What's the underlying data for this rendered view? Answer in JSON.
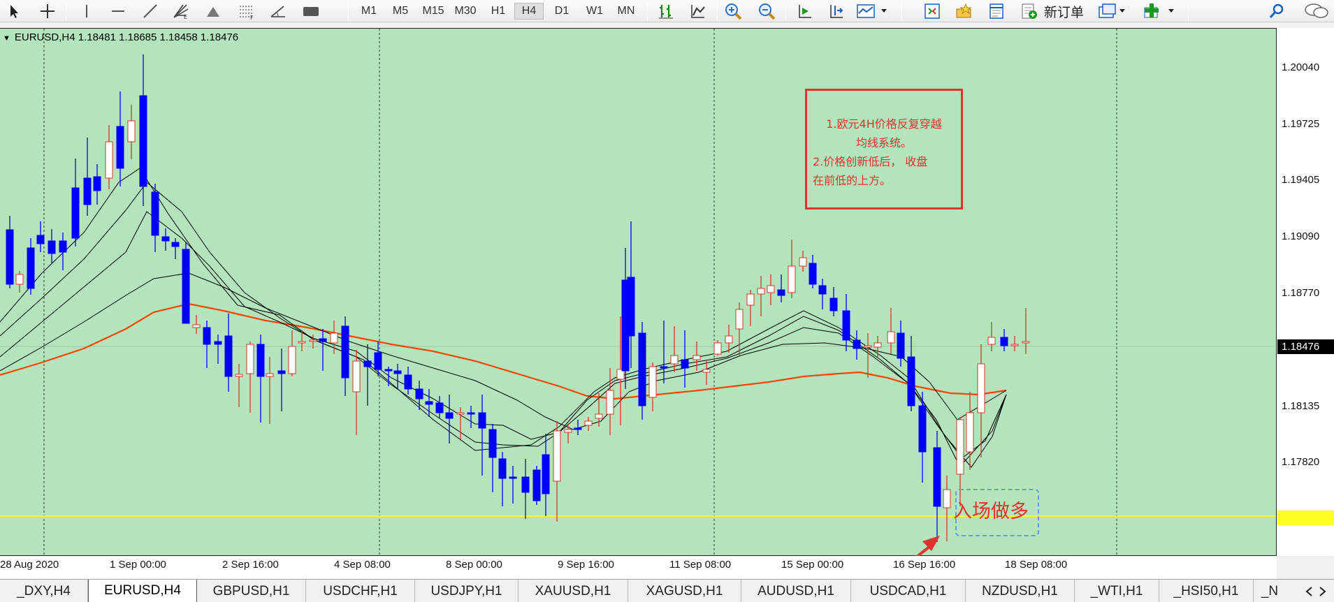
{
  "toolbar": {
    "tools": [
      "cursor-arrow",
      "crosshair",
      "vertical-line",
      "horizontal-line",
      "trend-line",
      "fibonacci-fan",
      "triangle-shape",
      "fibonacci-grid",
      "angle-line",
      "rectangle-shape"
    ],
    "timeframes": [
      "M1",
      "M5",
      "M15",
      "M30",
      "H1",
      "H4",
      "D1",
      "W1",
      "MN"
    ],
    "active_timeframe": "H4",
    "new_order_label": "新订单"
  },
  "chart": {
    "header": "EURUSD,H4  1.18481 1.18685 1.18458 1.18476",
    "background": "#b3e4bb",
    "price_labels": [
      "1.20040",
      "1.19725",
      "1.19405",
      "1.19090",
      "1.18770",
      "1.18135",
      "1.17820"
    ],
    "current_price": "1.18476",
    "line_price": "1.17527",
    "time_labels": [
      "28 Aug 2020",
      "1 Sep 00:00",
      "2 Sep 16:00",
      "4 Sep 08:00",
      "8 Sep 00:00",
      "9 Sep 16:00",
      "11 Sep 08:00",
      "15 Sep 00:00",
      "16 Sep 16:00",
      "18 Sep 08:00"
    ],
    "note_lines": [
      "1.欧元4H价格反复穿越",
      "均线系统。",
      "2.价格创新低后， 收盘",
      "在前低的上方。"
    ],
    "entry_label": "入场做多",
    "colors": {
      "bull_body": "#ffffff",
      "bull_wick": "#d23a2a",
      "bear": "#0000ff",
      "ma_slow": "#ff4500",
      "ma_fast": "#000000",
      "support_line": "#ffff20",
      "note": "#e2342f"
    }
  },
  "tabs": [
    "_DXY,H4",
    "EURUSD,H4",
    "GBPUSD,H1",
    "USDCHF,H1",
    "USDJPY,H1",
    "XAUUSD,H1",
    "XAGUSD,H1",
    "AUDUSD,H1",
    "USDCAD,H1",
    "NZDUSD,H1",
    "_WTI,H1",
    "_HSI50,H1",
    "_N"
  ],
  "active_tab": "EURUSD,H4"
}
